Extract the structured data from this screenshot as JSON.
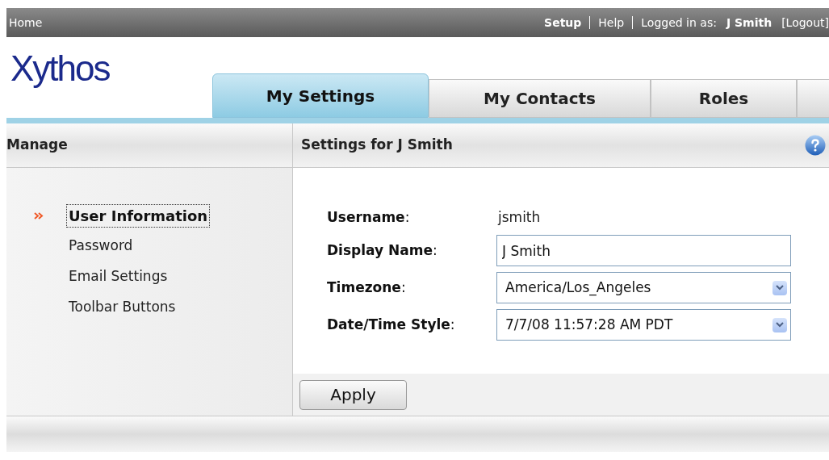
{
  "top_bar": {
    "home": "Home",
    "links": [
      {
        "label": "Setup",
        "bold": true
      },
      {
        "label": "Help",
        "bold": false
      }
    ],
    "logged_in_label": "Logged in as:",
    "user": "J Smith",
    "logout": "[Logout]"
  },
  "logo": "Xythos",
  "tabs": [
    {
      "label": "My Settings",
      "selected": true
    },
    {
      "label": "My Contacts",
      "selected": false
    },
    {
      "label": "Roles",
      "selected": false
    }
  ],
  "sidebar": {
    "title": "Manage",
    "items": [
      {
        "label": "User Information",
        "selected": true
      },
      {
        "label": "Password",
        "selected": false
      },
      {
        "label": "Email Settings",
        "selected": false
      },
      {
        "label": "Toolbar Buttons",
        "selected": false
      }
    ]
  },
  "panel": {
    "title": "Settings for J Smith",
    "fields": [
      {
        "kind": "text",
        "label": "Username",
        "colon": ":",
        "value": "jsmith"
      },
      {
        "kind": "input",
        "label": "Display Name",
        "colon": ":",
        "value": "J Smith"
      },
      {
        "kind": "select",
        "label": "Timezone",
        "colon": ":",
        "value": "America/Los_Angeles"
      },
      {
        "kind": "select",
        "label": "Date/Time Style",
        "colon": ":",
        "value": "7/7/08 11:57:28 AM PDT"
      }
    ],
    "apply": "Apply"
  }
}
